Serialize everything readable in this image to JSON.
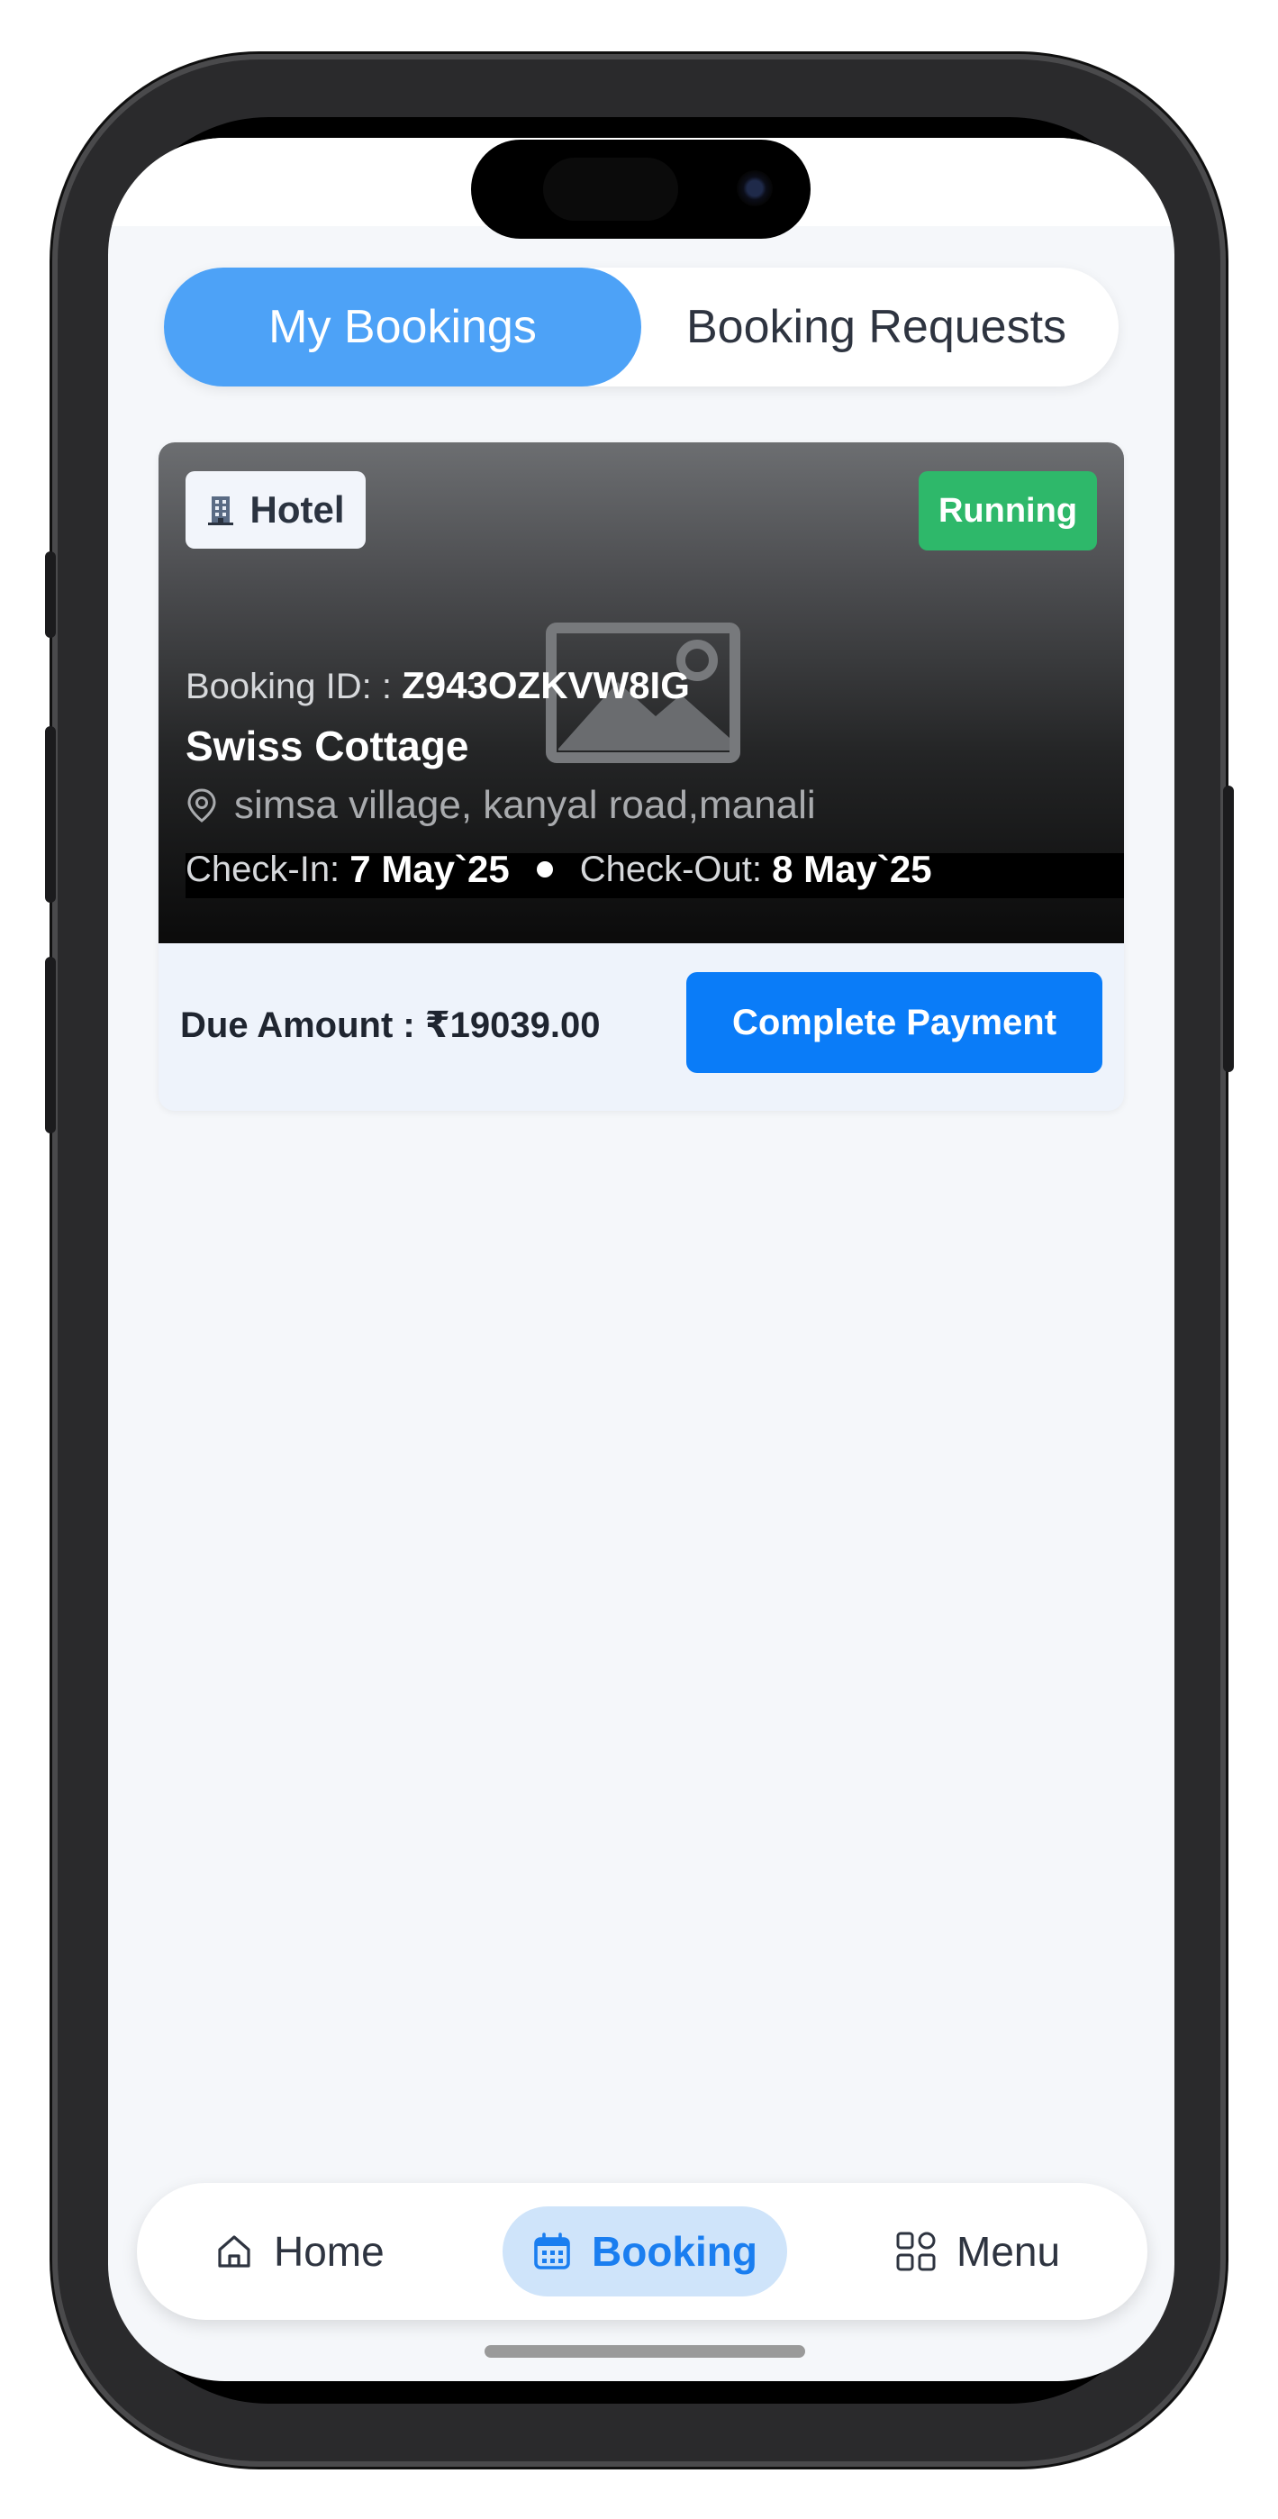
{
  "tabs": [
    {
      "label": "My Bookings",
      "active": true
    },
    {
      "label": "Booking Requests",
      "active": false
    }
  ],
  "booking": {
    "type_icon": "hotel-building-icon",
    "type_label": "Hotel",
    "status": "Running",
    "id_label": "Booking ID: :",
    "id_value": "Z943OZKVW8IG",
    "name": "Swiss Cottage",
    "address": "simsa village, kanyal road,manali",
    "check_in_label": "Check-In:",
    "check_in_value": "7 May`25",
    "check_out_label": "Check-Out:",
    "check_out_value": "8 May`25",
    "due_text": "Due Amount : ₹19039.00",
    "pay_button": "Complete Payment"
  },
  "nav": {
    "home": "Home",
    "booking": "Booking",
    "menu": "Menu",
    "active": "Booking"
  },
  "colors": {
    "active_tab": "#4da2f7",
    "status_running": "#2eb86a",
    "primary_button": "#0a7cf8",
    "nav_active_bg": "#cfe4fa",
    "nav_active_text": "#1a7ef0"
  }
}
